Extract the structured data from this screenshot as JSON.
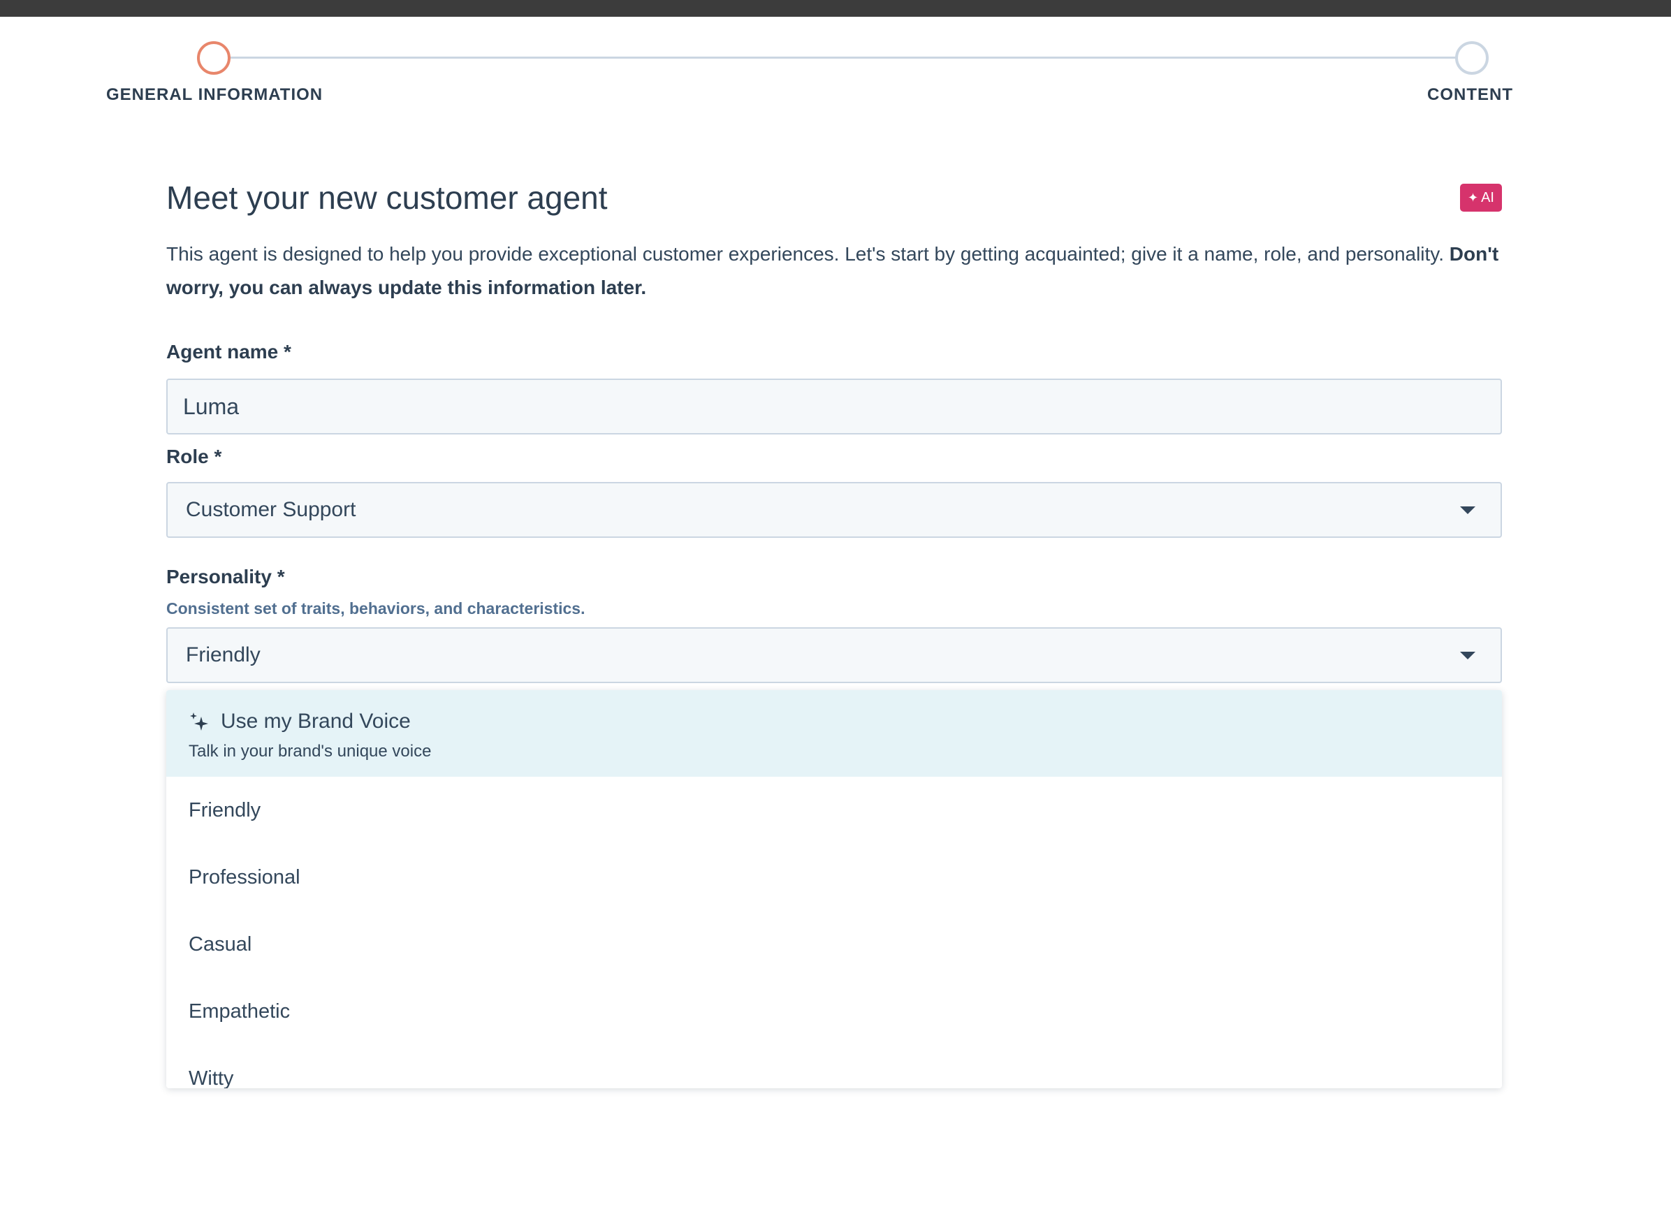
{
  "stepper": {
    "steps": [
      {
        "label": "GENERAL INFORMATION",
        "state": "active"
      },
      {
        "label": "CONTENT",
        "state": "upcoming"
      }
    ]
  },
  "header": {
    "title": "Meet your new customer agent",
    "ai_badge": "AI",
    "ai_badge_icon": "sparkle-icon"
  },
  "intro": {
    "text": "This agent is designed to help you provide exceptional customer experiences. Let's start by getting acquainted; give it a name, role, and personality. ",
    "bold_text": "Don't worry, you can always update this information later."
  },
  "form": {
    "agent_name": {
      "label": "Agent name *",
      "value": "Luma"
    },
    "role": {
      "label": "Role *",
      "value": "Customer Support"
    },
    "personality": {
      "label": "Personality *",
      "help": "Consistent set of traits, behaviors, and characteristics.",
      "value": "Friendly"
    }
  },
  "dropdown": {
    "brand_option": {
      "label": "Use my Brand Voice",
      "description": "Talk in your brand's unique voice",
      "icon": "sparkle-icon"
    },
    "options": [
      "Friendly",
      "Professional",
      "Casual",
      "Empathetic",
      "Witty"
    ]
  },
  "colors": {
    "active_step": "#e8866b",
    "inactive_step": "#cbd6e2",
    "ai_badge": "#d6336c",
    "highlight": "#e5f3f7",
    "text": "#33475b"
  }
}
